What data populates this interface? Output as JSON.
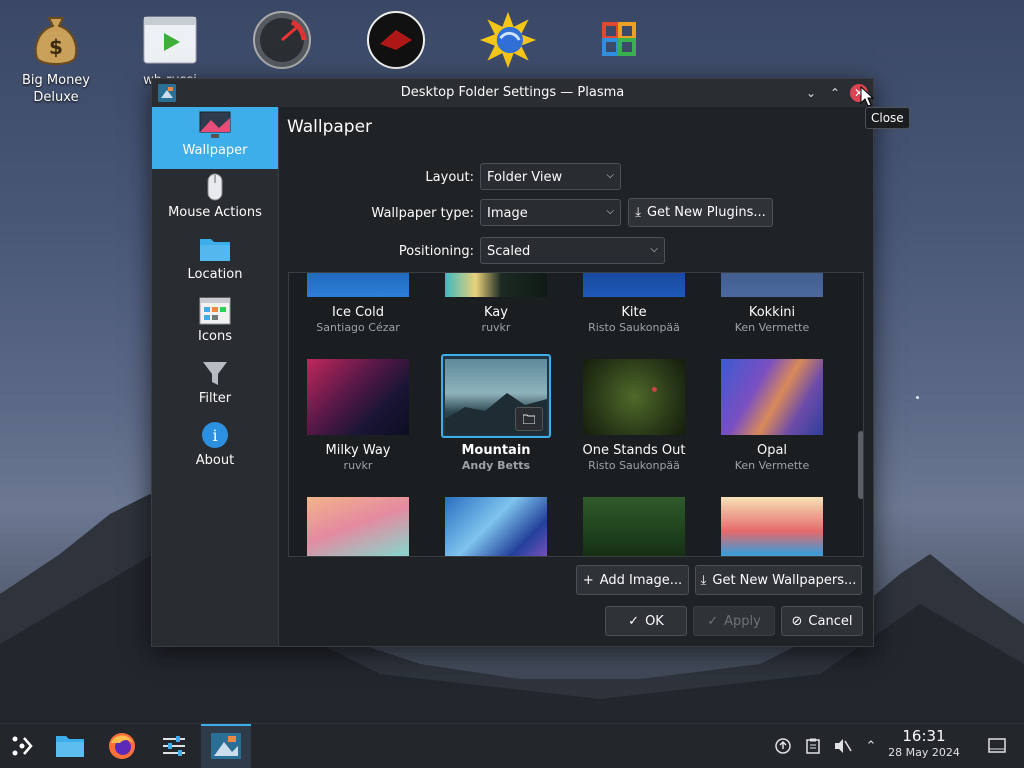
{
  "desktop": {
    "icons": [
      {
        "label": "Big Money Deluxe"
      },
      {
        "label": "wh russi"
      },
      {
        "label": ""
      },
      {
        "label": ""
      },
      {
        "label": ""
      },
      {
        "label": ""
      }
    ]
  },
  "window": {
    "title": "Desktop Folder Settings — Plasma",
    "tooltip": "Close"
  },
  "sidebar": {
    "items": [
      {
        "label": "Wallpaper",
        "active": true
      },
      {
        "label": "Mouse Actions"
      },
      {
        "label": "Location"
      },
      {
        "label": "Icons"
      },
      {
        "label": "Filter"
      },
      {
        "label": "About"
      }
    ]
  },
  "page": {
    "title": "Wallpaper",
    "layout_label": "Layout:",
    "layout_value": "Folder View",
    "wallpaper_type_label": "Wallpaper type:",
    "wallpaper_type_value": "Image",
    "get_plugins_label": "Get New Plugins...",
    "positioning_label": "Positioning:",
    "positioning_value": "Scaled"
  },
  "wallpapers": [
    {
      "name": "Ice Cold",
      "author": "Santiago Cézar"
    },
    {
      "name": "Kay",
      "author": "ruvkr"
    },
    {
      "name": "Kite",
      "author": "Risto Saukonpää"
    },
    {
      "name": "Kokkini",
      "author": "Ken Vermette"
    },
    {
      "name": "Milky Way",
      "author": "ruvkr"
    },
    {
      "name": "Mountain",
      "author": "Andy Betts",
      "selected": true
    },
    {
      "name": "One Stands Out",
      "author": "Risto Saukonpää"
    },
    {
      "name": "Opal",
      "author": "Ken Vermette"
    }
  ],
  "actions": {
    "add_image": "Add Image...",
    "get_wallpapers": "Get New Wallpapers...",
    "ok": "OK",
    "apply": "Apply",
    "cancel": "Cancel"
  },
  "taskbar": {
    "time": "16:31",
    "date": "28 May 2024"
  },
  "colors": {
    "accent": "#3daee9",
    "window_bg": "#202326",
    "close": "#da4453"
  }
}
